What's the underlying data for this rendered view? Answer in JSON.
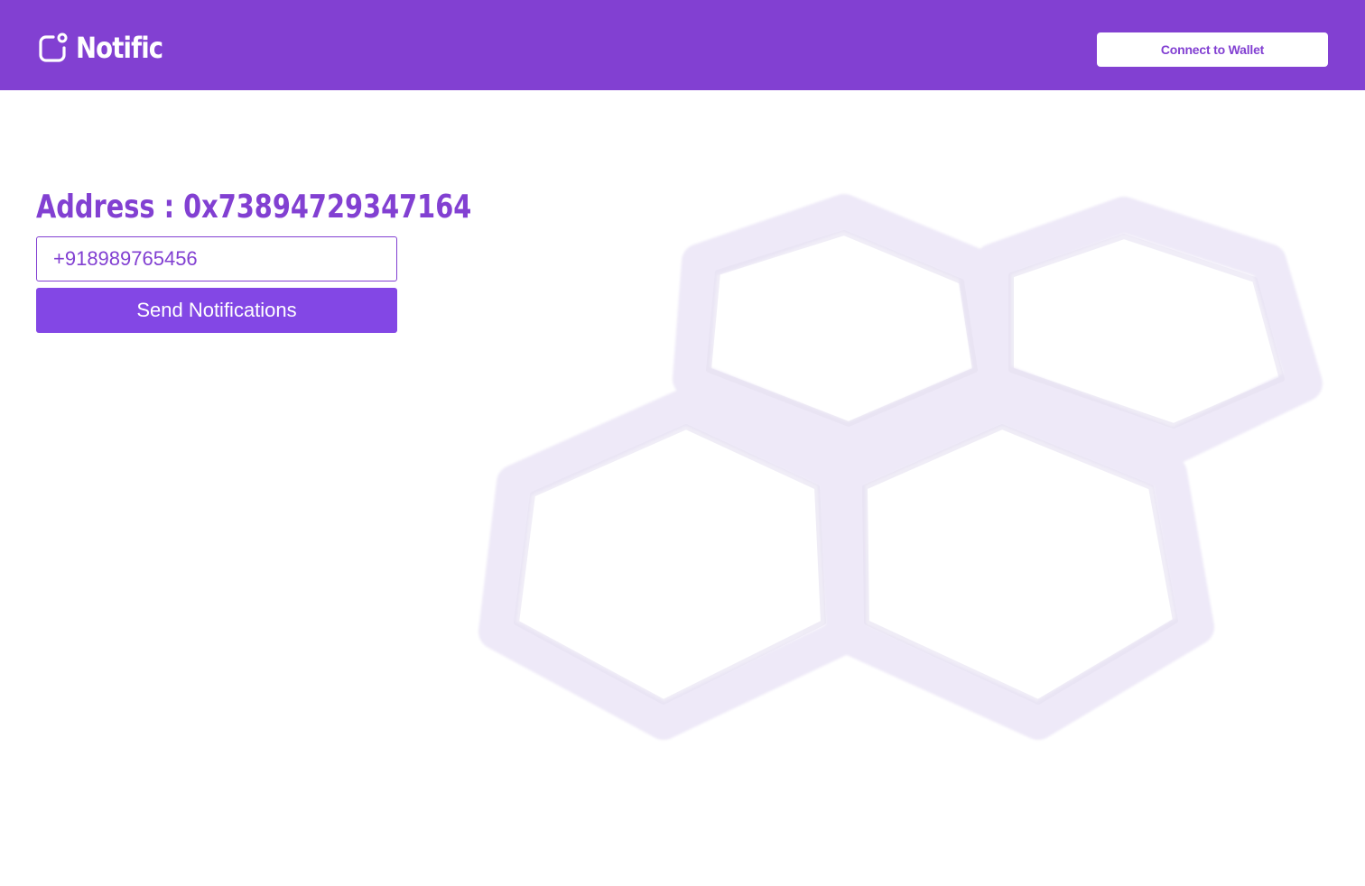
{
  "header": {
    "brand_name": "Notific",
    "logo_icon": "notification-bell-square-icon",
    "connect_label": "Connect to Wallet"
  },
  "main": {
    "address_text": "Address : 0x73894729347164",
    "phone_value": "+918989765456",
    "send_label": "Send Notifications"
  },
  "decoration": {
    "icon": "hexagon-cluster-icon"
  },
  "colors": {
    "accent": "#8240D2",
    "button": "#8347E5",
    "hex_fill": "#EFEAF8"
  }
}
